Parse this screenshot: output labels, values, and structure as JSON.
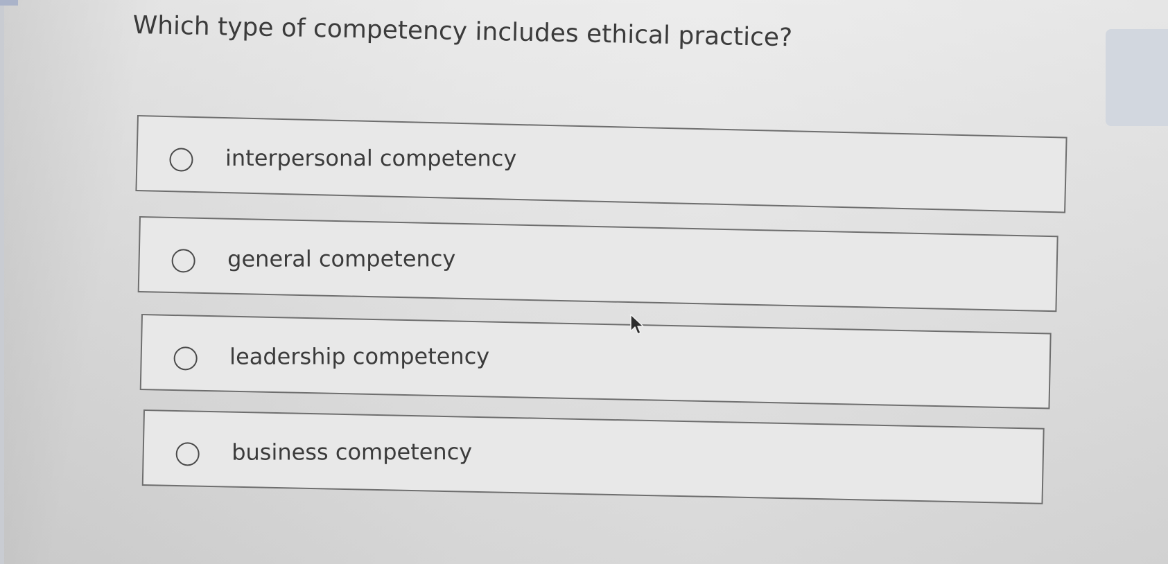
{
  "question": {
    "text": "Which type of competency includes ethical practice?"
  },
  "options": [
    {
      "label": "interpersonal competency",
      "selected": false
    },
    {
      "label": "general competency",
      "selected": false
    },
    {
      "label": "leadership competency",
      "selected": false
    },
    {
      "label": "business competency",
      "selected": false
    }
  ],
  "icons": {
    "radio": "radio-unchecked-icon",
    "cursor": "mouse-pointer-icon"
  },
  "colors": {
    "background": "#e4e4e4",
    "border": "#6e6e6e",
    "text": "#3b3b3b"
  }
}
